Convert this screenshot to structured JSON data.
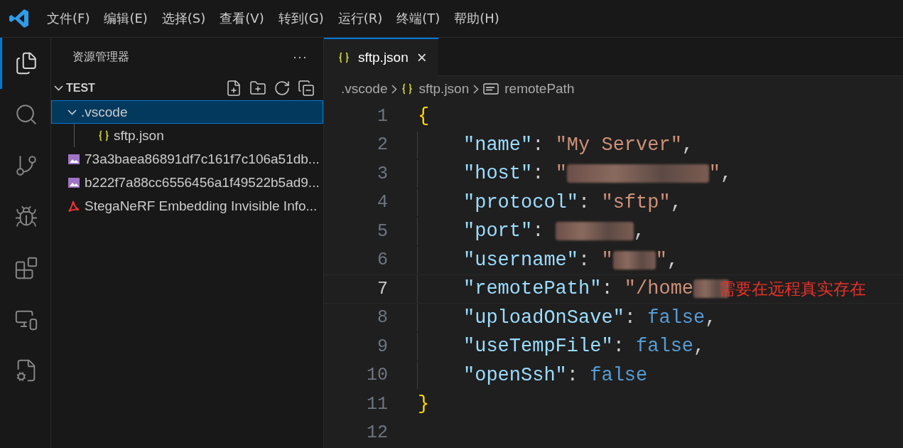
{
  "menu_bar": {
    "items": [
      "文件(F)",
      "编辑(E)",
      "选择(S)",
      "查看(V)",
      "转到(G)",
      "运行(R)",
      "终端(T)",
      "帮助(H)"
    ]
  },
  "activity_bar": {
    "items": [
      {
        "kind": "files",
        "selected": true
      },
      {
        "kind": "search",
        "selected": false
      },
      {
        "kind": "scm",
        "selected": false
      },
      {
        "kind": "debug",
        "selected": false
      },
      {
        "kind": "extensions",
        "selected": false
      },
      {
        "kind": "remote",
        "selected": false
      },
      {
        "kind": "sftp",
        "selected": false
      }
    ]
  },
  "sidebar": {
    "title": "资源管理器",
    "more": "···",
    "folder": {
      "name": "TEST",
      "expanded": true,
      "items": [
        {
          "name": ".vscode",
          "kind": "folder",
          "selected": true,
          "expanded": true,
          "children": [
            {
              "name": "sftp.json",
              "kind": "json",
              "selected": false
            }
          ]
        },
        {
          "name": "73a3baea86891df7c161f7c106a51db...",
          "kind": "image",
          "selected": false
        },
        {
          "name": "b222f7a88cc6556456a1f49522b5ad9...",
          "kind": "image",
          "selected": false
        },
        {
          "name": "StegaNeRF Embedding Invisible Info...",
          "kind": "pdf",
          "selected": false
        }
      ]
    }
  },
  "tabs": [
    {
      "label": "sftp.json",
      "selected": true,
      "close": "×"
    }
  ],
  "breadcrumbs": [
    {
      "label": ".vscode",
      "kind": "folder"
    },
    {
      "label": "sftp.json",
      "kind": "json"
    },
    {
      "label": "remotePath",
      "kind": "string"
    }
  ],
  "editor": {
    "lines": [
      {
        "number": "1",
        "current": false,
        "tokens": [
          {
            "kind": "brace",
            "text": "{"
          }
        ]
      },
      {
        "number": "2",
        "current": false,
        "tokens": [
          {
            "kind": "key",
            "text": "\"name\""
          },
          {
            "kind": "punct",
            "text": ": "
          },
          {
            "kind": "string",
            "text": "\"My Server\""
          },
          {
            "kind": "punct",
            "text": ","
          }
        ]
      },
      {
        "number": "3",
        "current": false,
        "tokens": [
          {
            "kind": "key",
            "text": "\"host\""
          },
          {
            "kind": "punct",
            "text": ": "
          },
          {
            "kind": "string",
            "text": "\""
          },
          {
            "kind": "blur"
          },
          {
            "kind": "string",
            "text": "\""
          },
          {
            "kind": "punct",
            "text": ","
          }
        ]
      },
      {
        "number": "4",
        "current": false,
        "tokens": [
          {
            "kind": "key",
            "text": "\"protocol\""
          },
          {
            "kind": "punct",
            "text": ": "
          },
          {
            "kind": "string",
            "text": "\"sftp\""
          },
          {
            "kind": "punct",
            "text": ","
          }
        ]
      },
      {
        "number": "5",
        "current": false,
        "tokens": [
          {
            "kind": "key",
            "text": "\"port\""
          },
          {
            "kind": "punct",
            "text": ": "
          },
          {
            "kind": "blur"
          },
          {
            "kind": "punct",
            "text": ","
          }
        ]
      },
      {
        "number": "6",
        "current": false,
        "tokens": [
          {
            "kind": "key",
            "text": "\"username\""
          },
          {
            "kind": "punct",
            "text": ": "
          },
          {
            "kind": "string",
            "text": "\""
          },
          {
            "kind": "blur"
          },
          {
            "kind": "string",
            "text": "\""
          },
          {
            "kind": "punct",
            "text": ","
          }
        ]
      },
      {
        "number": "7",
        "tokens": [
          {
            "kind": "key",
            "text": "\"remotePath\""
          },
          {
            "kind": "punct",
            "text": ": "
          },
          {
            "kind": "string",
            "text": "\"/home"
          },
          {
            "kind": "blur"
          }
        ],
        "annotation": "需要在远程真实存在",
        "current": true
      },
      {
        "number": "8",
        "current": false,
        "tokens": [
          {
            "kind": "key",
            "text": "\"uploadOnSave\""
          },
          {
            "kind": "punct",
            "text": ": "
          },
          {
            "kind": "bool",
            "text": "false"
          },
          {
            "kind": "punct",
            "text": ","
          }
        ]
      },
      {
        "number": "9",
        "current": false,
        "tokens": [
          {
            "kind": "key",
            "text": "\"useTempFile\""
          },
          {
            "kind": "punct",
            "text": ": "
          },
          {
            "kind": "bool",
            "text": "false"
          },
          {
            "kind": "punct",
            "text": ","
          }
        ]
      },
      {
        "number": "10",
        "current": false,
        "tokens": [
          {
            "kind": "key",
            "text": "\"openSsh\""
          },
          {
            "kind": "punct",
            "text": ": "
          },
          {
            "kind": "bool",
            "text": "false"
          }
        ]
      },
      {
        "number": "11",
        "current": false,
        "tokens": [
          {
            "kind": "brace",
            "text": "}"
          }
        ]
      },
      {
        "number": "12",
        "current": false
      }
    ]
  }
}
